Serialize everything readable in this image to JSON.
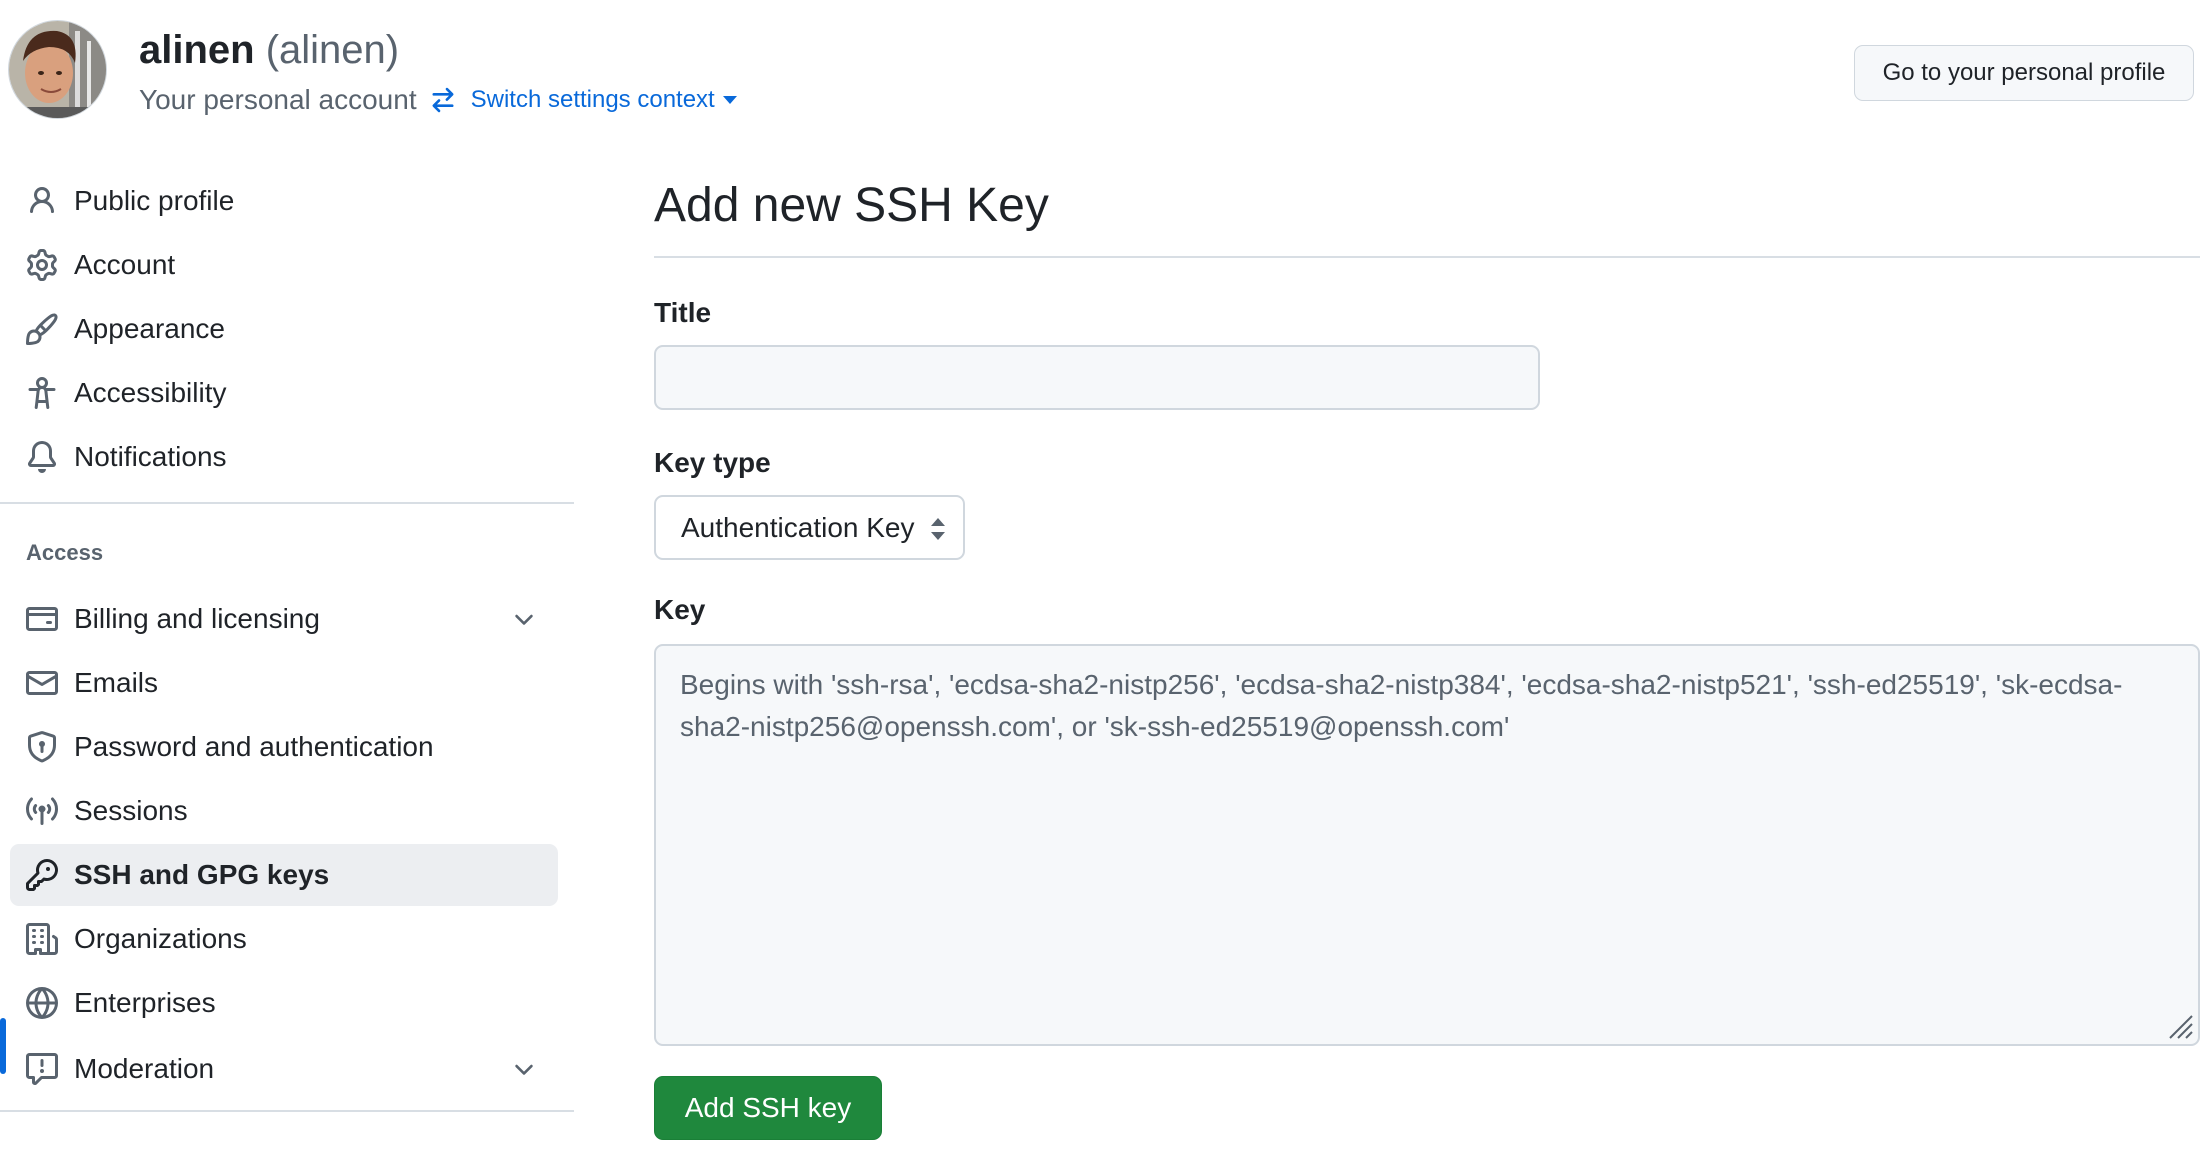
{
  "header": {
    "display_name": "alinen",
    "login": "(alinen)",
    "account_label": "Your personal account",
    "switch_context_label": "Switch settings context",
    "profile_button_label": "Go to your personal profile"
  },
  "sidebar": {
    "items": [
      {
        "label": "Public profile",
        "icon": "person-icon"
      },
      {
        "label": "Account",
        "icon": "gear-icon"
      },
      {
        "label": "Appearance",
        "icon": "paintbrush-icon"
      },
      {
        "label": "Accessibility",
        "icon": "accessibility-icon"
      },
      {
        "label": "Notifications",
        "icon": "bell-icon"
      }
    ],
    "access_heading": "Access",
    "access_items": [
      {
        "label": "Billing and licensing",
        "icon": "credit-card-icon",
        "expandable": true
      },
      {
        "label": "Emails",
        "icon": "mail-icon"
      },
      {
        "label": "Password and authentication",
        "icon": "shield-icon"
      },
      {
        "label": "Sessions",
        "icon": "broadcast-icon"
      },
      {
        "label": "SSH and GPG keys",
        "icon": "key-icon",
        "active": true
      },
      {
        "label": "Organizations",
        "icon": "organization-icon"
      },
      {
        "label": "Enterprises",
        "icon": "globe-icon"
      },
      {
        "label": "Moderation",
        "icon": "report-icon",
        "expandable": true
      }
    ]
  },
  "main": {
    "title": "Add new SSH Key",
    "title_field": {
      "label": "Title",
      "value": ""
    },
    "key_type": {
      "label": "Key type",
      "selected": "Authentication Key"
    },
    "key_field": {
      "label": "Key",
      "placeholder": "Begins with 'ssh-rsa', 'ecdsa-sha2-nistp256', 'ecdsa-sha2-nistp384', 'ecdsa-sha2-nistp521', 'ssh-ed25519', 'sk-ecdsa-sha2-nistp256@openssh.com', or 'sk-ssh-ed25519@openssh.com'"
    },
    "submit_label": "Add SSH key"
  },
  "colors": {
    "accent": "#0969da",
    "primary_button": "#1f883d",
    "muted_text": "#59636e",
    "border": "#d0d7de",
    "input_background": "#f6f8fa"
  }
}
